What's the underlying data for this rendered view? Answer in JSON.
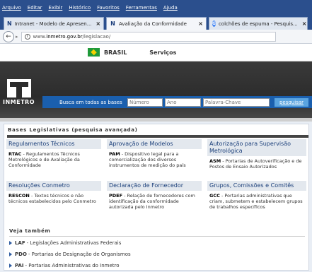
{
  "browser": {
    "menu": [
      "Arquivo",
      "Editar",
      "Exibir",
      "Histórico",
      "Favoritos",
      "Ferramentas",
      "Ajuda"
    ],
    "tabs": [
      {
        "icon": "intranet-icon",
        "label": "Intranet - Modelo de Apresen...",
        "active": false
      },
      {
        "icon": "intranet-icon",
        "label": "Avaliação da Conformidade",
        "active": true
      },
      {
        "icon": "google-icon",
        "label": "colchões de espuma - Pesquis...",
        "active": false
      }
    ],
    "url_prefix": "www.",
    "url_host": "inmetro.gov.br",
    "url_path": "/legislacao/"
  },
  "govbar": {
    "brasil": "BRASIL",
    "servicos": "Serviços"
  },
  "header": {
    "logo_text": "INMETRO",
    "search_label": "Busca em todas as bases",
    "numero_placeholder": "Número",
    "ano_placeholder": "Ano",
    "keyword_placeholder": "Palavra-Chave",
    "search_button": "pesquisar"
  },
  "bases": {
    "title": "Bases Legislativas",
    "subtitle": "(pesquisa avançada)"
  },
  "columns": [
    {
      "head": "Regulamentos Técnicos",
      "abbr": "RTAC",
      "desc": " - Regulamentos Técnicos Metrológicos e de Avaliação da Conformidade"
    },
    {
      "head": "Aprovação de Modelos",
      "abbr": "PAM",
      "desc": " - Dispositivo legal para a comercialização dos diversos instrumentos de medição do país"
    },
    {
      "head": "Autorização para Supervisão Metrológica",
      "abbr": "ASM",
      "desc": " - Portarias de Autoverificação e de Postos de Ensaio Autorizados"
    },
    {
      "head": "Resoluções Conmetro",
      "abbr": "RESCON",
      "desc": " - Textos técnicos e não técnicos estabelecidos pelo Conmetro"
    },
    {
      "head": "Declaração de Fornecedor",
      "abbr": "PDEF",
      "desc": " - Relação de fornecedores com identificação da conformidade autorizada pelo Inmetro"
    },
    {
      "head": "Grupos, Comissões e Comitês",
      "abbr": "GCC",
      "desc": " - Portarias administrativas que criam, submetem e estabelecem grupos de trabalhos específicos"
    }
  ],
  "veja": {
    "title": "Veja também",
    "links": [
      {
        "abbr": "LAF",
        "desc": " - Legislações Administrativas Federais"
      },
      {
        "abbr": "PDO",
        "desc": " - Portarias de Designação de Organismos"
      },
      {
        "abbr": "PAI",
        "desc": " - Portarias Administrativas do Inmetro"
      }
    ]
  }
}
